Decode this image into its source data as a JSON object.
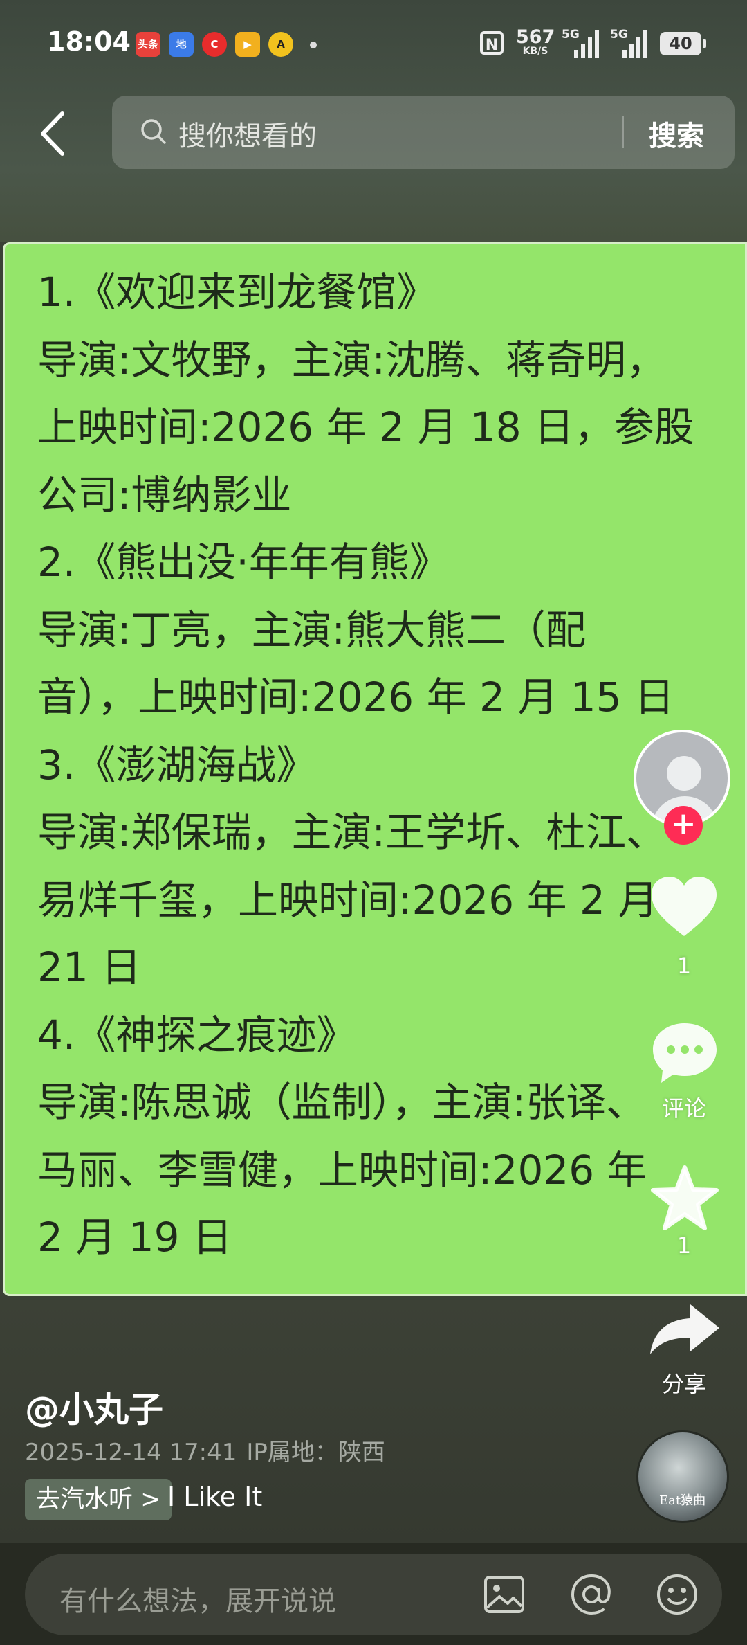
{
  "status_bar": {
    "time": "18:04",
    "notification_icons": [
      "头条",
      "地",
      "C",
      "▶",
      "A"
    ],
    "network_speed_value": "567",
    "network_speed_unit": "KB/S",
    "signal_1_label": "5G",
    "signal_2_label": "5G",
    "battery": "40"
  },
  "header": {
    "search_placeholder": "搜你想看的",
    "search_button": "搜索"
  },
  "post": {
    "lines": [
      "1.《欢迎来到龙餐馆》",
      "导演:文牧野，主演:沈腾、蒋奇明，",
      "上映时间:2026 年 2 月 18 日，参股",
      "公司:博纳影业",
      "2.《熊出没·年年有熊》",
      "导演:丁亮，主演:熊大熊二（配",
      "音），上映时间:2026 年 2 月 15 日",
      "3.《澎湖海战》",
      "导演:郑保瑞，主演:王学圻、杜江、",
      "易烊千玺，上映时间:2026 年 2 月",
      "21 日",
      "4.《神探之痕迹》",
      "导演:陈思诚（监制），主演:张译、",
      "马丽、李雪健，上映时间:2026 年",
      "2 月 19 日"
    ]
  },
  "actions": {
    "like_count": "1",
    "comment_label": "评论",
    "favorite_count": "1",
    "share_label": "分享"
  },
  "author": {
    "username": "@小丸子",
    "datetime": "2025-12-14 17:41",
    "ip_location": "IP属地：陕西"
  },
  "music": {
    "tag": "去汽水听 >",
    "title": "I Like It",
    "disc_text": "Eat猿曲"
  },
  "comment_bar": {
    "placeholder": "有什么想法，展开说说"
  },
  "colors": {
    "card_green": "#94e56a",
    "follow_red": "#fe2c55",
    "top_bar": "#46503f"
  }
}
